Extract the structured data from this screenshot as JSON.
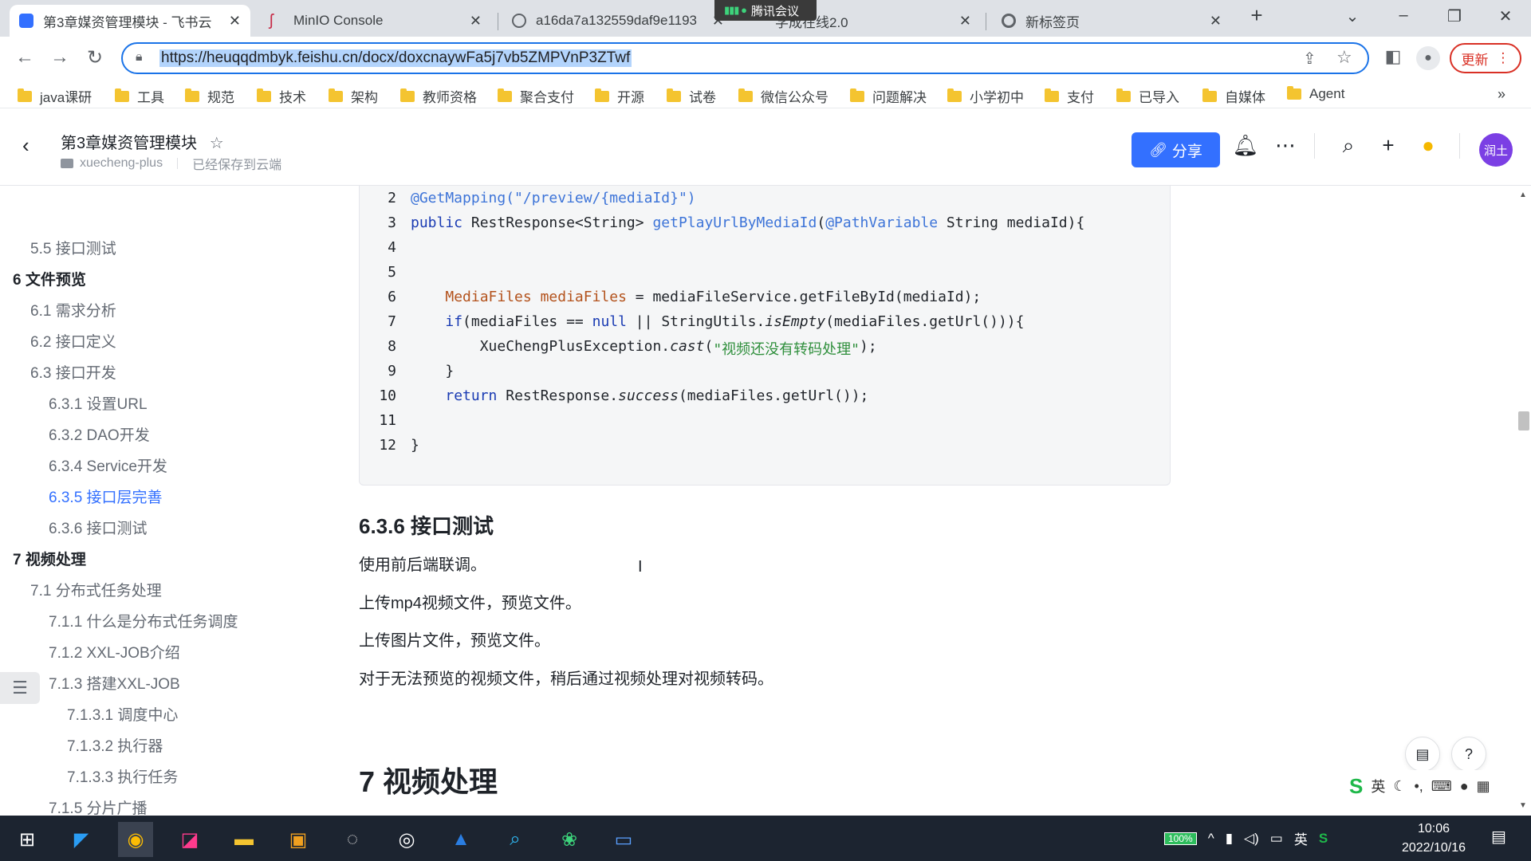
{
  "browser": {
    "tabs": [
      {
        "title": "第3章媒资管理模块 - 飞书云",
        "favicon_color": "#3370ff",
        "active": true
      },
      {
        "title": "MinIO Console",
        "favicon_color": "#c72c48",
        "active": false
      },
      {
        "title": "a16da7a132559daf9e1193",
        "favicon_color": "#5f6368",
        "active": false
      },
      {
        "title": "学成在线2.0",
        "favicon_color": "#5f6368",
        "active": false
      },
      {
        "title": "新标签页",
        "favicon_color": "#5f6368",
        "active": false
      }
    ],
    "meeting_label": "腾讯会议",
    "url": "https://heuqqdmbyk.feishu.cn/docx/doxcnaywFa5j7vb5ZMPVnP3ZTwf",
    "update_label": "更新",
    "bookmarks": [
      "java课研",
      "工具",
      "规范",
      "技术",
      "架构",
      "教师资格",
      "聚合支付",
      "开源",
      "试卷",
      "微信公众号",
      "问题解决",
      "小学初中",
      "支付",
      "已导入",
      "自媒体",
      "Agent"
    ]
  },
  "doc": {
    "title": "第3章媒资管理模块",
    "workspace": "xuecheng-plus",
    "save_status": "已经保存到云端",
    "share_label": "分享",
    "avatar_text": "润土"
  },
  "outline": [
    {
      "text": "5.5 接口测试",
      "level": 2,
      "active": false
    },
    {
      "text": "6 文件预览",
      "level": 1,
      "active": false
    },
    {
      "text": "6.1 需求分析",
      "level": 2,
      "active": false
    },
    {
      "text": "6.2 接口定义",
      "level": 2,
      "active": false
    },
    {
      "text": "6.3 接口开发",
      "level": 2,
      "active": false
    },
    {
      "text": "6.3.1 设置URL",
      "level": 3,
      "active": false
    },
    {
      "text": "6.3.2 DAO开发",
      "level": 3,
      "active": false
    },
    {
      "text": "6.3.4 Service开发",
      "level": 3,
      "active": false
    },
    {
      "text": "6.3.5 接口层完善",
      "level": 3,
      "active": true
    },
    {
      "text": "6.3.6 接口测试",
      "level": 3,
      "active": false
    },
    {
      "text": "7 视频处理",
      "level": 1,
      "active": false
    },
    {
      "text": "7.1 分布式任务处理",
      "level": 2,
      "active": false
    },
    {
      "text": "7.1.1 什么是分布式任务调度",
      "level": 3,
      "active": false
    },
    {
      "text": "7.1.2 XXL-JOB介绍",
      "level": 3,
      "active": false
    },
    {
      "text": "7.1.3 搭建XXL-JOB",
      "level": 3,
      "active": false
    },
    {
      "text": "7.1.3.1 调度中心",
      "level": 4,
      "active": false
    },
    {
      "text": "7.1.3.2 执行器",
      "level": 4,
      "active": false
    },
    {
      "text": "7.1.3.3 执行任务",
      "level": 4,
      "active": false
    },
    {
      "text": "7.1.5 分片广播",
      "level": 3,
      "active": false
    }
  ],
  "code": {
    "line_numbers": [
      "2",
      "3",
      "4",
      "5",
      "6",
      "7",
      "8",
      "9",
      "10",
      "11",
      "12"
    ],
    "l2_annotation": "@GetMapping(\"/preview/{mediaId}\")",
    "l3_public": "public",
    "l3_type": " RestResponse<String> ",
    "l3_method": "getPlayUrlByMediaId",
    "l3_paren": "(",
    "l3_param_ann": "@PathVariable",
    "l3_rest": " String mediaId){",
    "l6_type": "MediaFiles mediaFiles",
    "l6_rest": " = mediaFileService.getFileById(mediaId);",
    "l7_if": "if",
    "l7_a": "(mediaFiles == ",
    "l7_null": "null",
    "l7_b": " || StringUtils.",
    "l7_isempty": "isEmpty",
    "l7_c": "(mediaFiles.getUrl())){",
    "l8_a": "XueChengPlusException.",
    "l8_cast": "cast",
    "l8_b": "(",
    "l8_str": "\"视频还没有转码处理\"",
    "l8_c": ");",
    "l9": "}",
    "l10_return": "return",
    "l10_a": " RestResponse.",
    "l10_success": "success",
    "l10_b": "(mediaFiles.getUrl());",
    "l12": "}"
  },
  "content": {
    "heading_636": "6.3.6 接口测试",
    "paragraphs": [
      "使用前后端联调。",
      "上传mp4视频文件，预览文件。",
      "上传图片文件，预览文件。",
      "对于无法预览的视频文件，稍后通过视频处理对视频转码。"
    ],
    "heading_7": "7 视频处理"
  },
  "ime": {
    "mode": "英"
  },
  "taskbar": {
    "battery": "100%",
    "lang": "英",
    "time": "10:06",
    "date": "2022/10/16"
  }
}
